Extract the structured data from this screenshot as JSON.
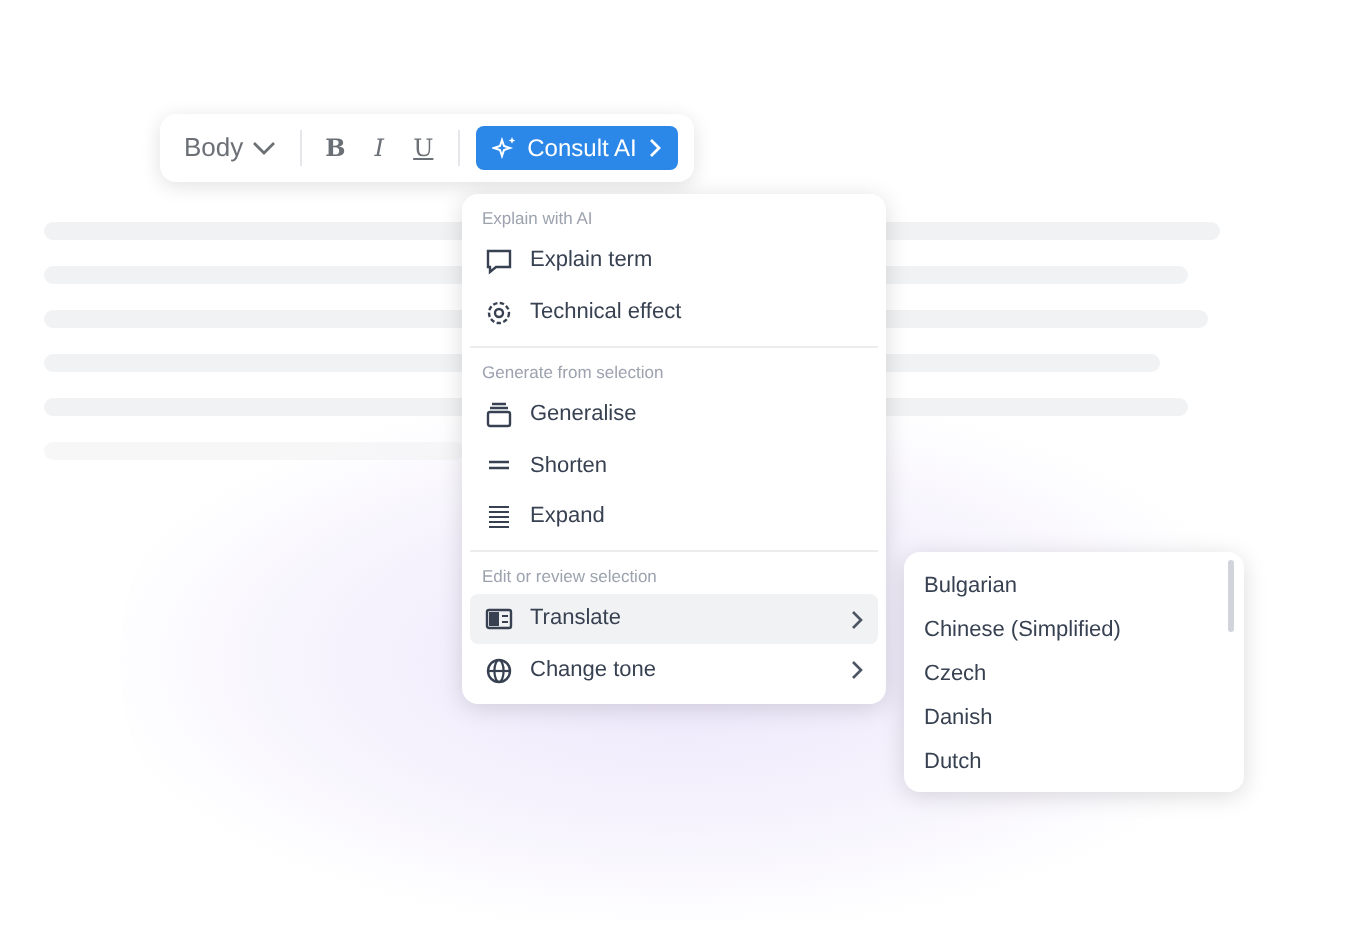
{
  "toolbar": {
    "style_dropdown": "Body",
    "format_buttons": [
      {
        "label": "B",
        "kind": "bold"
      },
      {
        "label": "I",
        "kind": "italic"
      },
      {
        "label": "U",
        "kind": "underline"
      }
    ],
    "consult_button": "Consult AI"
  },
  "menu": {
    "sections": [
      {
        "heading": "Explain with AI",
        "items": [
          {
            "label": "Explain term",
            "selected": false,
            "submenu": false
          },
          {
            "label": "Technical effect",
            "selected": false,
            "submenu": false
          }
        ]
      },
      {
        "heading": "Generate from selection",
        "items": [
          {
            "label": "Generalise",
            "selected": false,
            "submenu": false
          },
          {
            "label": "Shorten",
            "selected": false,
            "submenu": false
          },
          {
            "label": "Expand",
            "selected": false,
            "submenu": false
          }
        ]
      },
      {
        "heading": "Edit or review selection",
        "items": [
          {
            "label": "Translate",
            "selected": true,
            "submenu": true
          },
          {
            "label": "Change tone",
            "selected": false,
            "submenu": true
          }
        ]
      }
    ]
  },
  "languages": [
    "Bulgarian",
    "Chinese (Simplified)",
    "Czech",
    "Danish",
    "Dutch"
  ]
}
